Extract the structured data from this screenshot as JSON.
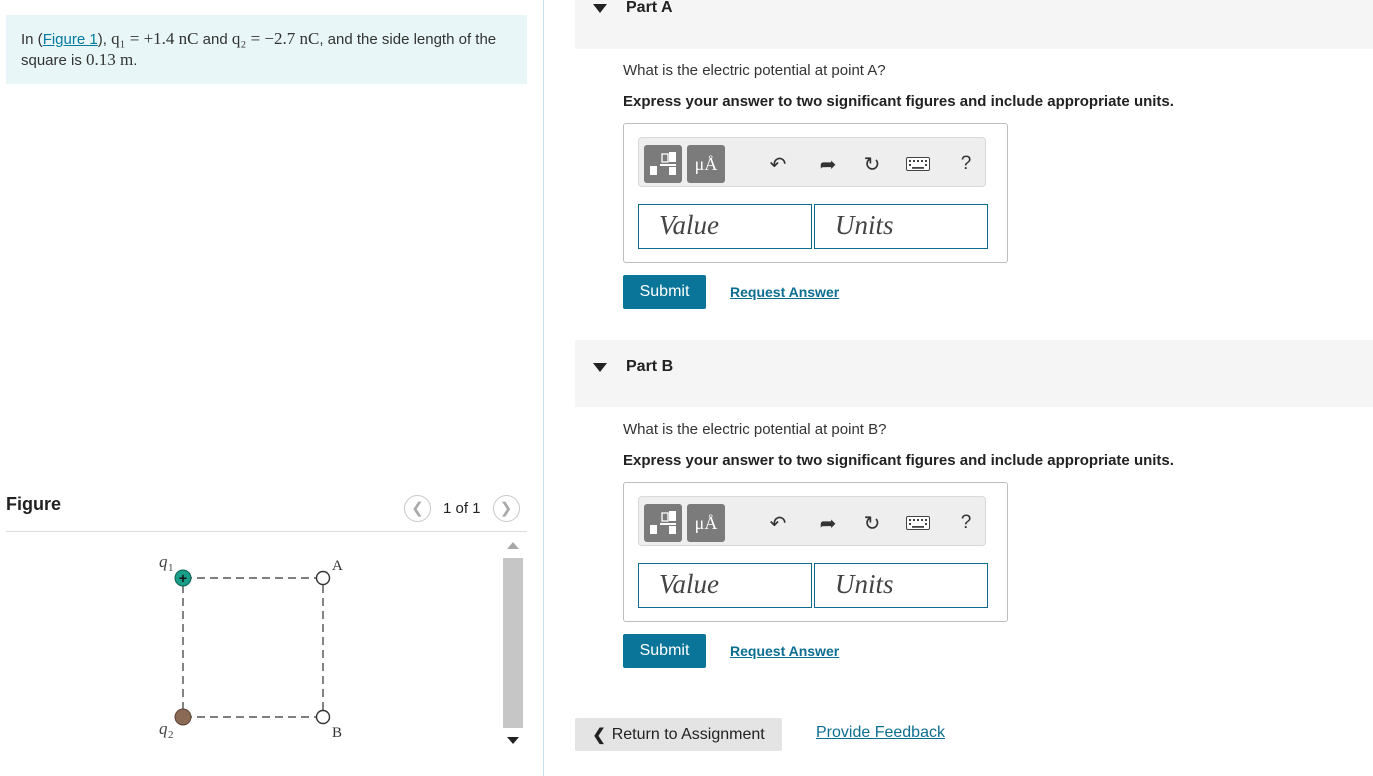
{
  "intro": {
    "text_in": "In (",
    "figure_link": "Figure 1",
    "text_close": "), ",
    "q1_expr": "q₁ = +1.4 nC",
    "text_and": " and ",
    "q2_expr": "q₂ = −2.7 nC",
    "text_side": ", and the side length of the square is ",
    "side_value": "0.13 m",
    "period": "."
  },
  "figure": {
    "title": "Figure",
    "pager": "1 of 1",
    "labels": {
      "q1": "q",
      "q1_sub": "1",
      "q2": "q",
      "q2_sub": "2",
      "A": "A",
      "B": "B"
    },
    "colors": {
      "q1_charge": "#1a9e8a",
      "q2_charge": "#8a6a55"
    }
  },
  "toolbar": {
    "units_label": "μÅ",
    "help": "?"
  },
  "parts": [
    {
      "label": "Part A",
      "question": "What is the electric potential at point A?",
      "instruction": "Express your answer to two significant figures and include appropriate units.",
      "value_placeholder": "Value",
      "units_placeholder": "Units",
      "submit": "Submit",
      "request": "Request Answer"
    },
    {
      "label": "Part B",
      "question": "What is the electric potential at point B?",
      "instruction": "Express your answer to two significant figures and include appropriate units.",
      "value_placeholder": "Value",
      "units_placeholder": "Units",
      "submit": "Submit",
      "request": "Request Answer"
    }
  ],
  "footer": {
    "return": "Return to Assignment",
    "feedback": "Provide Feedback"
  }
}
